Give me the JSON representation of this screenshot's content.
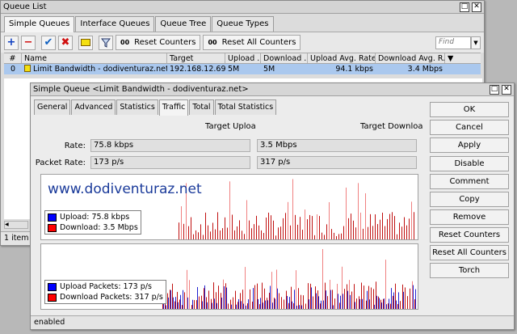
{
  "queue_list": {
    "title": "Queue List",
    "tabs": [
      "Simple Queues",
      "Interface Queues",
      "Queue Tree",
      "Queue Types"
    ],
    "toolbar": {
      "reset_counters": "Reset Counters",
      "reset_all_counters": "Reset All Counters",
      "counter_glyph": "00"
    },
    "find_placeholder": "Find",
    "columns": [
      "#",
      "Name",
      "Target",
      "Upload ...",
      "Download ...",
      "Upload Avg. Rate",
      "Download Avg. R..."
    ],
    "row": {
      "num": "0",
      "name": "Limit Bandwidth - dodiventuraz.net",
      "target": "192.168.12.69",
      "upload": "5M",
      "download": "5M",
      "upload_avg": "94.1 kbps",
      "download_avg": "3.4 Mbps"
    },
    "status": "1 item"
  },
  "simple_queue": {
    "title": "Simple Queue <Limit Bandwidth - dodiventuraz.net>",
    "tabs": [
      "General",
      "Advanced",
      "Statistics",
      "Traffic",
      "Total",
      "Total Statistics"
    ],
    "col_upload": "Target Uploa",
    "col_download": "Target Downloa",
    "rate_label": "Rate:",
    "rate_upload": "75.8 kbps",
    "rate_download": "3.5 Mbps",
    "packet_label": "Packet Rate:",
    "packet_upload": "173 p/s",
    "packet_download": "317 p/s",
    "watermark": "www.dodiventuraz.net",
    "legend_bw": [
      {
        "label": "Upload:  75.8 kbps",
        "color": "#0000ff"
      },
      {
        "label": "Download:  3.5 Mbps",
        "color": "#ff0000"
      }
    ],
    "legend_pk": [
      {
        "label": "Upload Packets:  173 p/s",
        "color": "#0000ff"
      },
      {
        "label": "Download Packets:  317 p/s",
        "color": "#ff0000"
      }
    ],
    "buttons": [
      "OK",
      "Cancel",
      "Apply",
      "Disable",
      "Comment",
      "Copy",
      "Remove",
      "Reset Counters",
      "Reset All Counters",
      "Torch"
    ],
    "status": "enabled"
  },
  "colors": {
    "download_bar": "#c01010",
    "upload_bar": "#2020d0",
    "download_spike": "#f08080",
    "selection": "#aac8ee"
  }
}
